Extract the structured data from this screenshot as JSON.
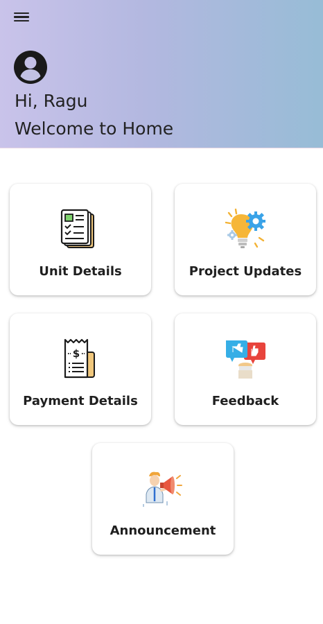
{
  "header": {
    "menu_icon": "hamburger-menu-icon",
    "avatar_icon": "account-circle-icon",
    "greeting": "Hi, Ragu",
    "welcome": "Welcome to Home"
  },
  "menu": [
    {
      "label": "Unit Details",
      "icon": "document-checklist-icon"
    },
    {
      "label": "Project Updates",
      "icon": "lightbulb-gear-icon"
    },
    {
      "label": "Payment Details",
      "icon": "receipt-icon"
    },
    {
      "label": "Feedback",
      "icon": "feedback-chat-icon"
    },
    {
      "label": "Announcement",
      "icon": "megaphone-person-icon"
    }
  ],
  "colors": {
    "header_gradient_start": "#c9c3ea",
    "header_gradient_end": "#97bcd6",
    "card_background": "#ffffff",
    "text": "#1f1f1f"
  }
}
